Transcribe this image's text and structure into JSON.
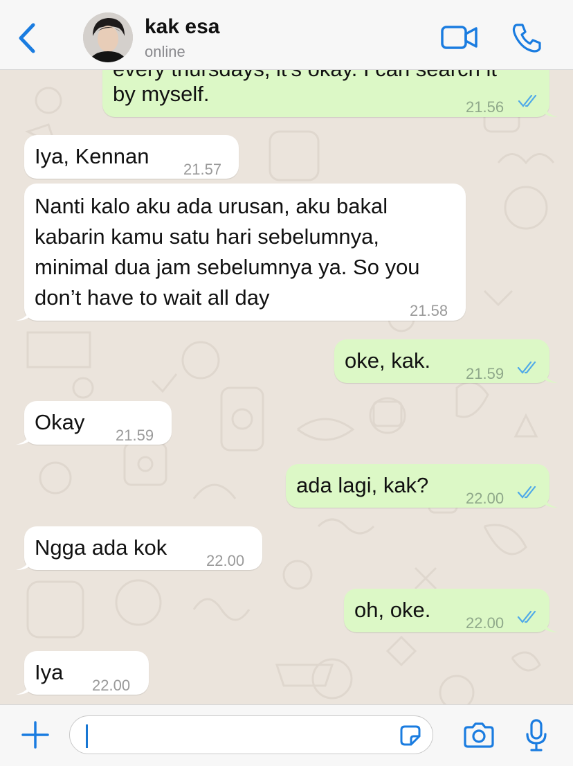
{
  "header": {
    "back_icon": "chevron-left-icon",
    "contact_name": "kak esa",
    "status": "online",
    "video_icon": "video-camera-icon",
    "call_icon": "phone-icon"
  },
  "messages": [
    {
      "direction": "out",
      "text_top": "every thursdays, it's okay. I can search it",
      "text": "by myself.",
      "time": "21.56",
      "read": true
    },
    {
      "direction": "in",
      "text": "Iya, Kennan",
      "time": "21.57"
    },
    {
      "direction": "in",
      "lines": [
        "Nanti kalo aku ada urusan, aku bakal",
        "kabarin kamu satu hari sebelumnya,",
        "minimal dua jam sebelumnya ya. So you",
        "don’t have to wait all day"
      ],
      "time": "21.58"
    },
    {
      "direction": "out",
      "text": "oke, kak.",
      "time": "21.59",
      "read": true
    },
    {
      "direction": "in",
      "text": "Okay",
      "time": "21.59"
    },
    {
      "direction": "out",
      "text": "ada lagi, kak?",
      "time": "22.00",
      "read": true
    },
    {
      "direction": "in",
      "text": "Ngga ada kok",
      "time": "22.00"
    },
    {
      "direction": "out",
      "text": "oh, oke.",
      "time": "22.00",
      "read": true
    },
    {
      "direction": "in",
      "text": "Iya",
      "time": "22.00"
    }
  ],
  "input_bar": {
    "plus_icon": "plus-icon",
    "message_value": "",
    "sticker_icon": "sticker-icon",
    "camera_icon": "camera-icon",
    "mic_icon": "microphone-icon"
  },
  "colors": {
    "accent": "#1a7ce0",
    "outgoing_bubble": "#dcf8c6",
    "incoming_bubble": "#ffffff",
    "chat_background": "#ebe4dc",
    "read_tick": "#4fa9e8"
  }
}
